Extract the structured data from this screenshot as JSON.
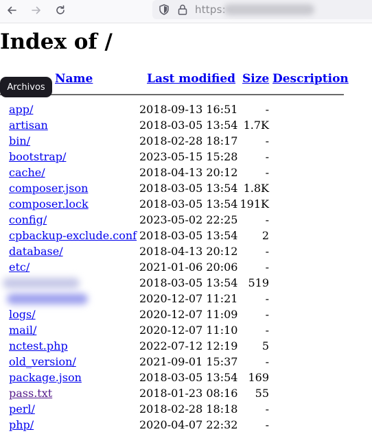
{
  "browser": {
    "url_prefix": "https:"
  },
  "page": {
    "title": "Index of /",
    "tooltip": "Archivos",
    "columns": {
      "name": "Name",
      "last_modified": "Last modified",
      "size": "Size",
      "description": "Description"
    },
    "rows": [
      {
        "name": "app/",
        "date": "2018-09-13 16:51",
        "size": "-"
      },
      {
        "name": "artisan",
        "date": "2018-03-05 13:54",
        "size": "1.7K"
      },
      {
        "name": "bin/",
        "date": "2018-02-28 18:17",
        "size": "-"
      },
      {
        "name": "bootstrap/",
        "date": "2023-05-15 15:28",
        "size": "-"
      },
      {
        "name": "cache/",
        "date": "2018-04-13 20:12",
        "size": "-"
      },
      {
        "name": "composer.json",
        "date": "2018-03-05 13:54",
        "size": "1.8K"
      },
      {
        "name": "composer.lock",
        "date": "2018-03-05 13:54",
        "size": "191K"
      },
      {
        "name": "config/",
        "date": "2023-05-02 22:25",
        "size": "-"
      },
      {
        "name": "cpbackup-exclude.conf",
        "date": "2018-03-05 13:54",
        "size": "2"
      },
      {
        "name": "database/",
        "date": "2018-04-13 20:12",
        "size": "-"
      },
      {
        "name": "etc/",
        "date": "2021-01-06 20:06",
        "size": "-"
      },
      {
        "name": "",
        "date": "2018-03-05 13:54",
        "size": "519"
      },
      {
        "name": "",
        "date": "2020-12-07 11:21",
        "size": "-"
      },
      {
        "name": "logs/",
        "date": "2020-12-07 11:09",
        "size": "-"
      },
      {
        "name": "mail/",
        "date": "2020-12-07 11:10",
        "size": "-"
      },
      {
        "name": "nctest.php",
        "date": "2022-07-12 12:19",
        "size": "5"
      },
      {
        "name": "old_version/",
        "date": "2021-09-01 15:37",
        "size": "-"
      },
      {
        "name": "package.json",
        "date": "2018-03-05 13:54",
        "size": "169"
      },
      {
        "name": "pass.txt",
        "date": "2018-01-23 08:16",
        "size": "55",
        "visited": true
      },
      {
        "name": "perl/",
        "date": "2018-02-28 18:18",
        "size": "-"
      },
      {
        "name": "php/",
        "date": "2020-04-07 22:32",
        "size": "-"
      }
    ]
  },
  "colors": {
    "link": "#0000ee",
    "visited_link": "#551a8b"
  }
}
